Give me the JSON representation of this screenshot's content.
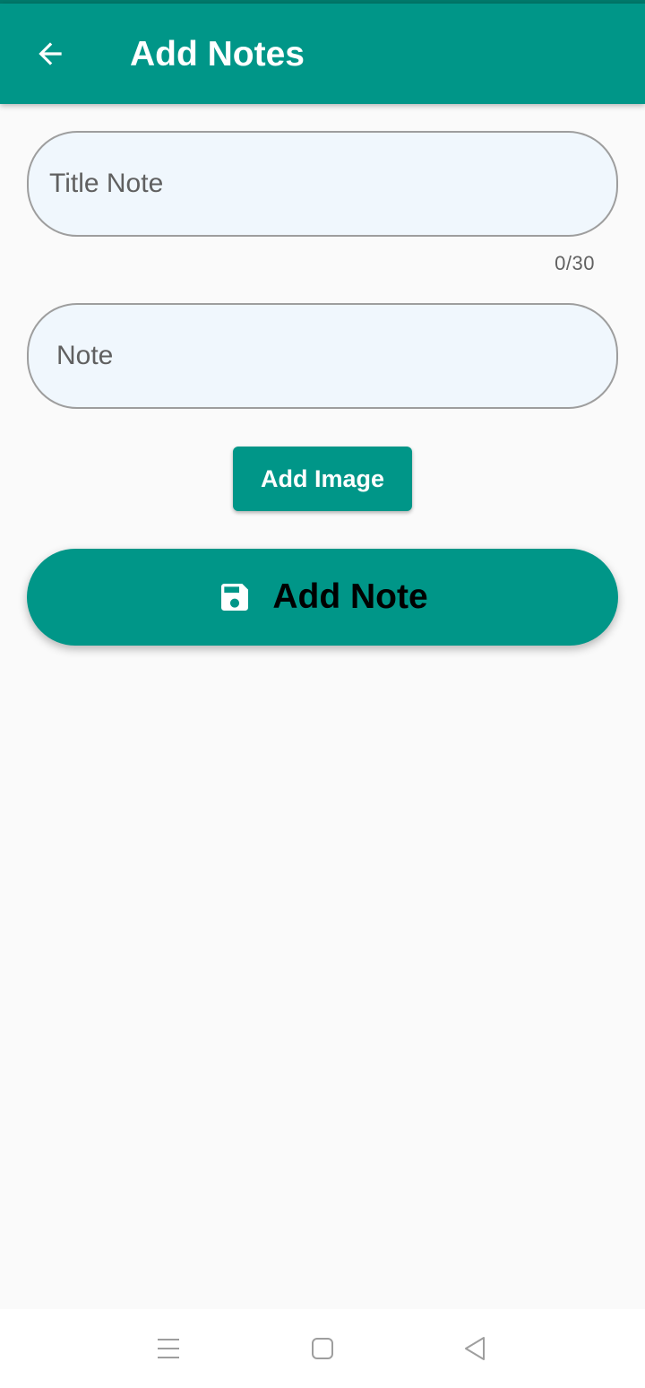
{
  "app_bar": {
    "title": "Add Notes",
    "back_icon": "arrow-back-icon",
    "background": "#009688"
  },
  "form": {
    "title_field": {
      "placeholder": "Title Note",
      "value": ""
    },
    "title_counter": "0/30",
    "note_field": {
      "placeholder": "Note",
      "value": ""
    },
    "add_image_label": "Add Image",
    "add_note_label": "Add Note",
    "add_note_icon": "save-icon"
  },
  "nav_bar": {
    "icons": [
      "menu-icon",
      "home-square-icon",
      "back-triangle-icon"
    ]
  },
  "colors": {
    "accent": "#009688",
    "status_strip": "#00796b",
    "field_fill": "#f0f7fd",
    "field_border": "#9e9e9e",
    "background": "#fafafa"
  }
}
